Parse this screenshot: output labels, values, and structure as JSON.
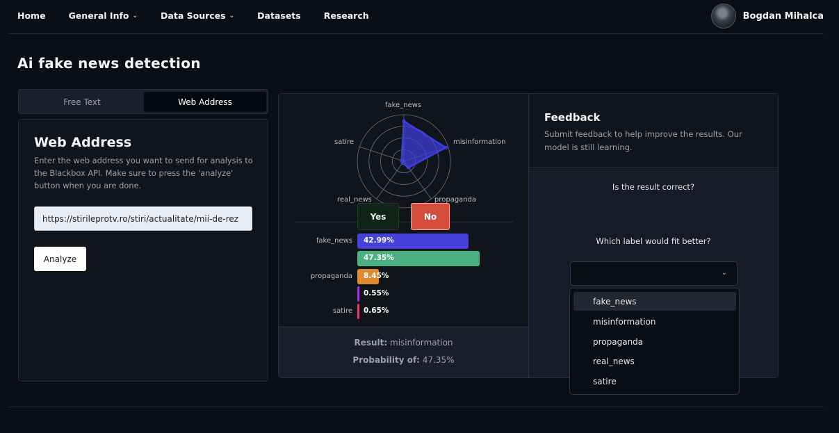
{
  "nav": {
    "links": [
      {
        "label": "Home"
      },
      {
        "label": "General Info"
      },
      {
        "label": "Data Sources"
      },
      {
        "label": "Datasets"
      },
      {
        "label": "Research"
      }
    ],
    "user_name": "Bogdan Mihalca"
  },
  "page": {
    "title": "Ai fake news detection"
  },
  "tabs": {
    "free_text": "Free Text",
    "web_address": "Web Address",
    "active": "Web Address"
  },
  "web_address_card": {
    "title": "Web Address",
    "description": "Enter the web address you want to send for analysis to the Blackbox API. Make sure to press the 'analyze' button when you are done.",
    "url_value": "https://stirileprotv.ro/stiri/actualitate/mii-de-rez",
    "analyze_label": "Analyze"
  },
  "chart_data": [
    {
      "type": "radar",
      "categories": [
        "fake_news",
        "misinformation",
        "propaganda",
        "real_news",
        "satire"
      ],
      "values": [
        42.99,
        47.35,
        8.45,
        0.55,
        0.65
      ],
      "color": "#3d3ee0"
    },
    {
      "type": "bar",
      "orientation": "horizontal",
      "categories": [
        "fake_news",
        "",
        "propaganda",
        "",
        "satire"
      ],
      "values": [
        42.99,
        47.35,
        8.45,
        0.55,
        0.65
      ],
      "value_labels": [
        "42.99%",
        "47.35%",
        "8.45%",
        "0.55%",
        "0.65%"
      ],
      "colors": [
        "#4641d8",
        "#4bb07f",
        "#df8b2f",
        "#9b3ad0",
        "#d0426a"
      ]
    }
  ],
  "result": {
    "result_label": "Result:",
    "result_value": "misinformation",
    "prob_label": "Probability of:",
    "prob_value": "47.35%"
  },
  "feedback": {
    "title": "Feedback",
    "description": "Submit feedback to help improve the results. Our model is still learning.",
    "question": "Is the result correct?",
    "yes_label": "Yes",
    "no_label": "No",
    "label_question": "Which label would fit better?",
    "options": [
      "fake_news",
      "misinformation",
      "propaganda",
      "real_news",
      "satire"
    ],
    "highlighted_option": "fake_news"
  }
}
